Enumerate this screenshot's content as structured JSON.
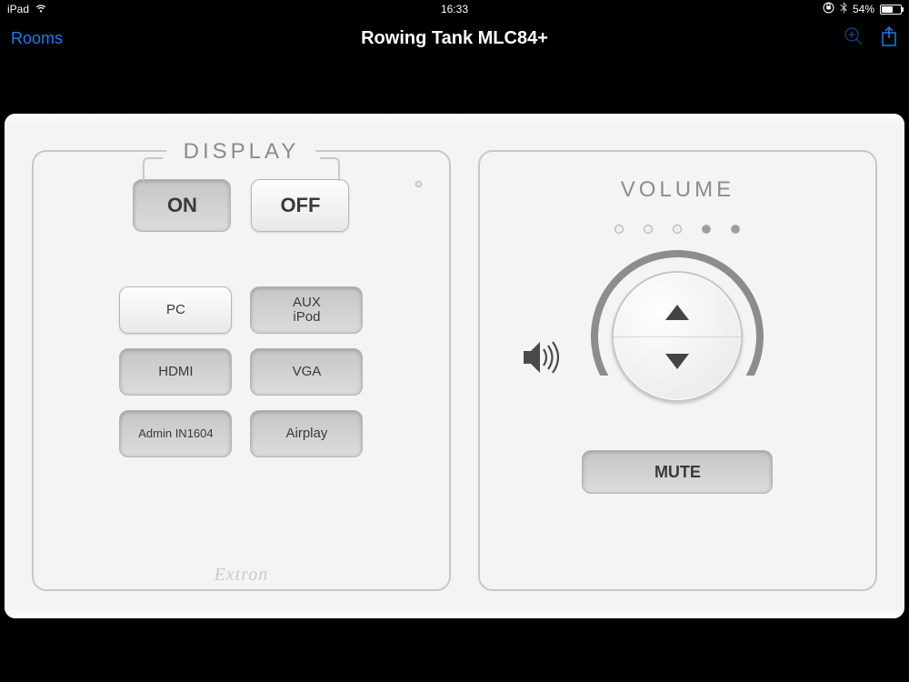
{
  "status": {
    "carrier": "iPad",
    "time": "16:33",
    "battery_pct": "54%"
  },
  "nav": {
    "back": "Rooms",
    "title": "Rowing Tank MLC84+"
  },
  "display": {
    "legend": "DISPLAY",
    "on": "ON",
    "off": "OFF",
    "sources": [
      {
        "label": "PC"
      },
      {
        "label": "AUX\niPod"
      },
      {
        "label": "HDMI"
      },
      {
        "label": "VGA"
      },
      {
        "label": "Admin IN1604"
      },
      {
        "label": "Airplay"
      }
    ],
    "brand": "Extron"
  },
  "volume": {
    "title": "VOLUME",
    "mute": "MUTE"
  }
}
